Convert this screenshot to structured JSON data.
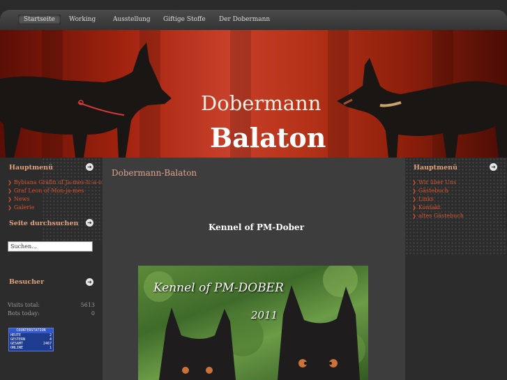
{
  "nav": {
    "items": [
      "Startseite",
      "Working",
      "Ausstellung",
      "Giftige Stoffe",
      "Der Dobermann"
    ]
  },
  "banner": {
    "title_line1": "Dobermann",
    "title_line2": "Balaton"
  },
  "left": {
    "menu_title": "Hauptmenü",
    "menu_items": [
      "Bybiana Grafin of Ja-mes-Ic-a-on",
      "Graf Leon of Mon-ja-mes",
      "News",
      "Galerie"
    ],
    "search_title": "Seite durchsuchen",
    "search_value": "Suchen...",
    "visitors_title": "Besucher",
    "visits_label": "Visits total:",
    "visits_value": "5613",
    "bots_label": "Bots today:",
    "bots_value": "0",
    "counter": {
      "title": "COUNTERSTATION",
      "rows": [
        {
          "label": "HEUTE",
          "value": "2"
        },
        {
          "label": "GESTERN",
          "value": "4"
        },
        {
          "label": "GESAMT",
          "value": "2467"
        },
        {
          "label": "ONLINE",
          "value": "1"
        }
      ]
    }
  },
  "right": {
    "menu_title": "Hauptmenü",
    "menu_items": [
      "Wir über Uns",
      "Gästebuch",
      "Links",
      "Kontakt",
      "altes Gästebuch"
    ]
  },
  "main": {
    "title": "Dobermann-Balaton",
    "heading": "Kennel of PM-Dober",
    "photo_text1": "Kennel of PM-DOBER",
    "photo_text2": "2011"
  },
  "colors": {
    "accent": "#d9542e",
    "title": "#e3a07c",
    "banner_red": "#b53218"
  }
}
